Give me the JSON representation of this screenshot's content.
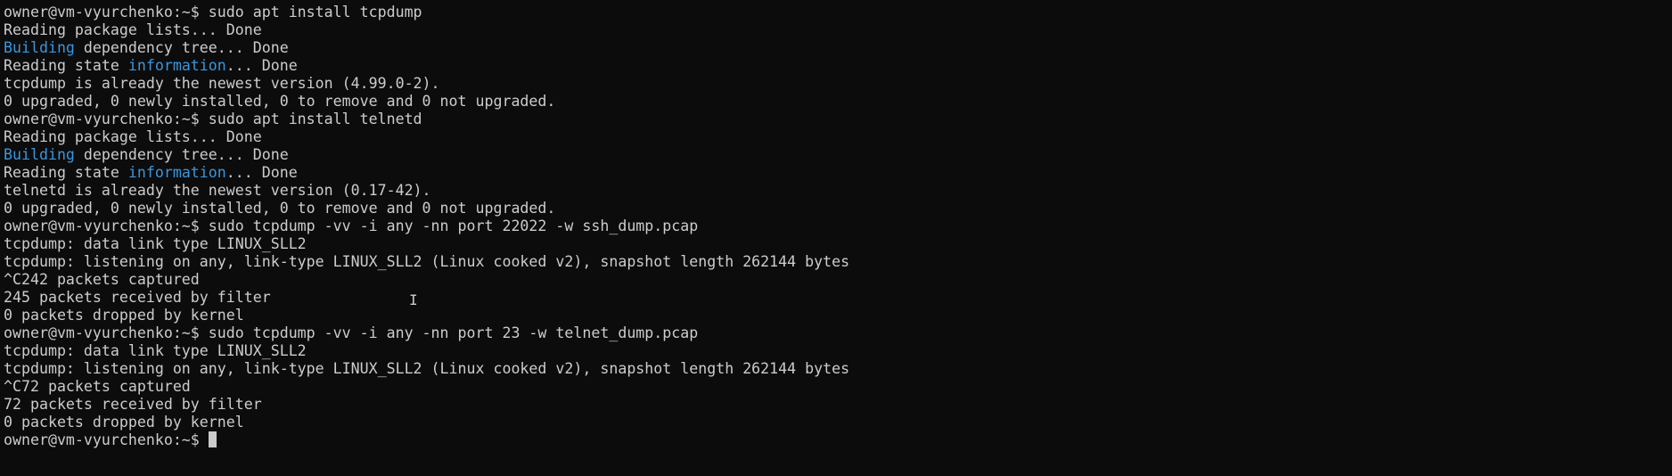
{
  "terminal": {
    "colors": {
      "background": "#0c0c0c",
      "foreground": "#cccccc",
      "highlight": "#3a96dd"
    },
    "lines": [
      [
        {
          "t": "owner@vm-vyurchenko:~$ sudo apt install tcpdump"
        }
      ],
      [
        {
          "t": "Reading package lists... Done"
        }
      ],
      [
        {
          "t": "Building",
          "c": "blue"
        },
        {
          "t": " dependency tree... Done"
        }
      ],
      [
        {
          "t": "Reading state "
        },
        {
          "t": "information",
          "c": "blue"
        },
        {
          "t": "... Done"
        }
      ],
      [
        {
          "t": "tcpdump is already the newest version (4.99.0-2)."
        }
      ],
      [
        {
          "t": "0 upgraded, 0 newly installed, 0 to remove and 0 not upgraded."
        }
      ],
      [
        {
          "t": "owner@vm-vyurchenko:~$ sudo apt install telnetd"
        }
      ],
      [
        {
          "t": "Reading package lists... Done"
        }
      ],
      [
        {
          "t": "Building",
          "c": "blue"
        },
        {
          "t": " dependency tree... Done"
        }
      ],
      [
        {
          "t": "Reading state "
        },
        {
          "t": "information",
          "c": "blue"
        },
        {
          "t": "... Done"
        }
      ],
      [
        {
          "t": "telnetd is already the newest version (0.17-42)."
        }
      ],
      [
        {
          "t": "0 upgraded, 0 newly installed, 0 to remove and 0 not upgraded."
        }
      ],
      [
        {
          "t": "owner@vm-vyurchenko:~$ sudo tcpdump -vv -i any -nn port 22022 -w ssh_dump.pcap"
        }
      ],
      [
        {
          "t": "tcpdump: data link type LINUX_SLL2"
        }
      ],
      [
        {
          "t": "tcpdump: listening on any, link-type LINUX_SLL2 (Linux cooked v2), snapshot length 262144 bytes"
        }
      ],
      [
        {
          "t": "^C242 packets captured"
        }
      ],
      [
        {
          "t": "245 packets received by filter"
        }
      ],
      [
        {
          "t": "0 packets dropped by kernel"
        }
      ],
      [
        {
          "t": "owner@vm-vyurchenko:~$ sudo tcpdump -vv -i any -nn port 23 -w telnet_dump.pcap"
        }
      ],
      [
        {
          "t": "tcpdump: data link type LINUX_SLL2"
        }
      ],
      [
        {
          "t": "tcpdump: listening on any, link-type LINUX_SLL2 (Linux cooked v2), snapshot length 262144 bytes"
        }
      ],
      [
        {
          "t": "^C72 packets captured"
        }
      ],
      [
        {
          "t": "72 packets received by filter"
        }
      ],
      [
        {
          "t": "0 packets dropped by kernel"
        }
      ],
      [
        {
          "t": "owner@vm-vyurchenko:~$ "
        }
      ]
    ],
    "cursor_icon": "text-cursor-block",
    "mouse_icon": "i-beam-cursor-icon"
  }
}
